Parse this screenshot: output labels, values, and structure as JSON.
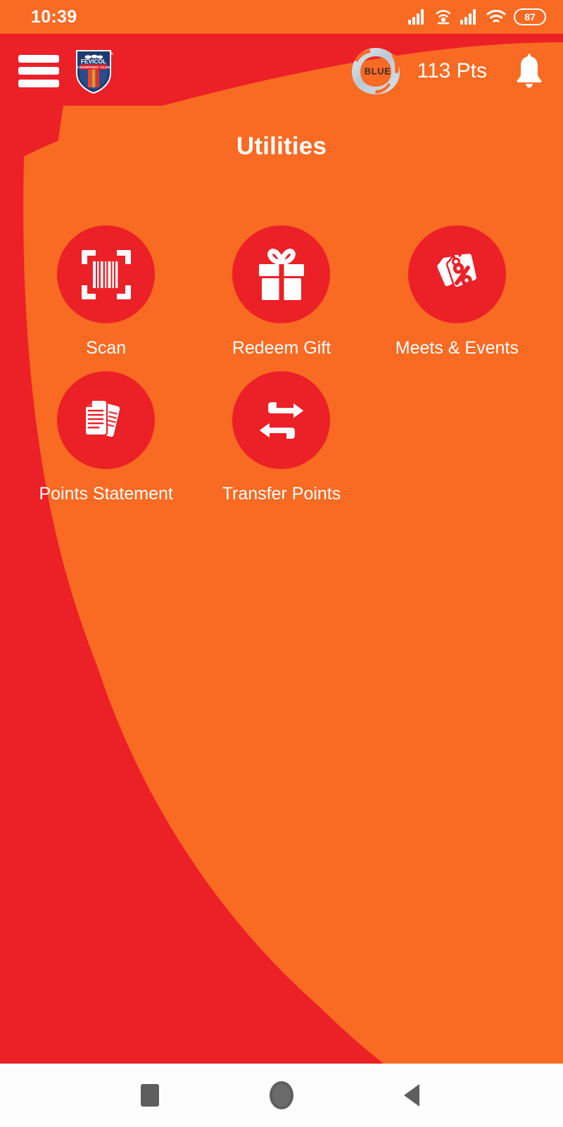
{
  "status_bar": {
    "clock": "10:39",
    "battery_level": "87",
    "icons": [
      "signal-bars-icon",
      "hotspot-icon",
      "signal-bars-icon",
      "wifi-icon",
      "battery-icon"
    ]
  },
  "header": {
    "menu_icon": "hamburger-menu-icon",
    "brand_name": "FEVICOL",
    "brand_subtitle": "CHAMPIONS' CLUB",
    "brand_tm": "TM",
    "tier_label": "BLUE",
    "points_text": "113 Pts",
    "notification_icon": "bell-icon"
  },
  "page": {
    "title": "Utilities"
  },
  "utilities": [
    {
      "label": "Scan",
      "icon": "barcode-scan-icon",
      "id": "scan"
    },
    {
      "label": "Redeem Gift",
      "icon": "gift-box-icon",
      "id": "redeem-gift"
    },
    {
      "label": "Meets & Events",
      "icon": "discount-tags-icon",
      "id": "meets-events"
    },
    {
      "label": "Points Statement",
      "icon": "documents-icon",
      "id": "points-statement"
    },
    {
      "label": "Transfer Points",
      "icon": "transfer-arrows-icon",
      "id": "transfer-points"
    }
  ],
  "android_nav": {
    "recents": "recents-square-icon",
    "home": "home-circle-icon",
    "back": "back-triangle-icon"
  },
  "colors": {
    "orange_background": "#F96A22",
    "red_accent": "#EC2027",
    "icon_white": "#FFFFFF",
    "tier_silver": "#C9D4DC",
    "navbar_background": "#FDFDFD",
    "navbar_icon": "#5E5E5E"
  }
}
